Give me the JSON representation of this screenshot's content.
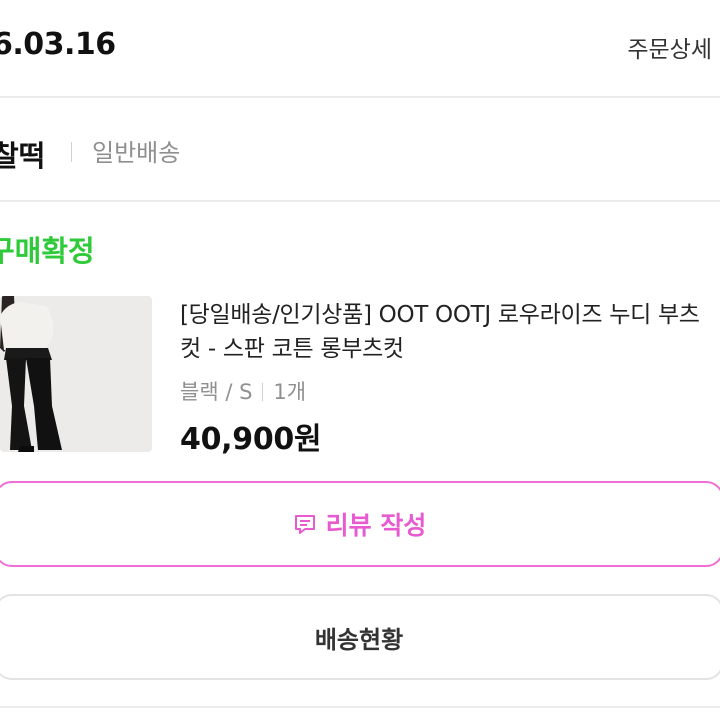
{
  "order": {
    "date": "6.03.16",
    "detail_link": "주문상세"
  },
  "seller": {
    "name": "찰떡",
    "shipping_type": "일반배송"
  },
  "status": {
    "label": "구매확정",
    "color": "#2fca39"
  },
  "product": {
    "image_icon": "jeans-model-photo",
    "name": "[당일배송/인기상품] OOT OOTJ 로우라이즈 누디 부츠컷 - 스판 코튼 롱부츠컷",
    "option": "블랙 / S",
    "quantity": "1개",
    "price": "40,900원"
  },
  "actions": {
    "review_label": "리뷰 작성",
    "review_icon": "chat-edit-icon",
    "review_color": "#e85bd0",
    "tracking_label": "배송현황"
  }
}
